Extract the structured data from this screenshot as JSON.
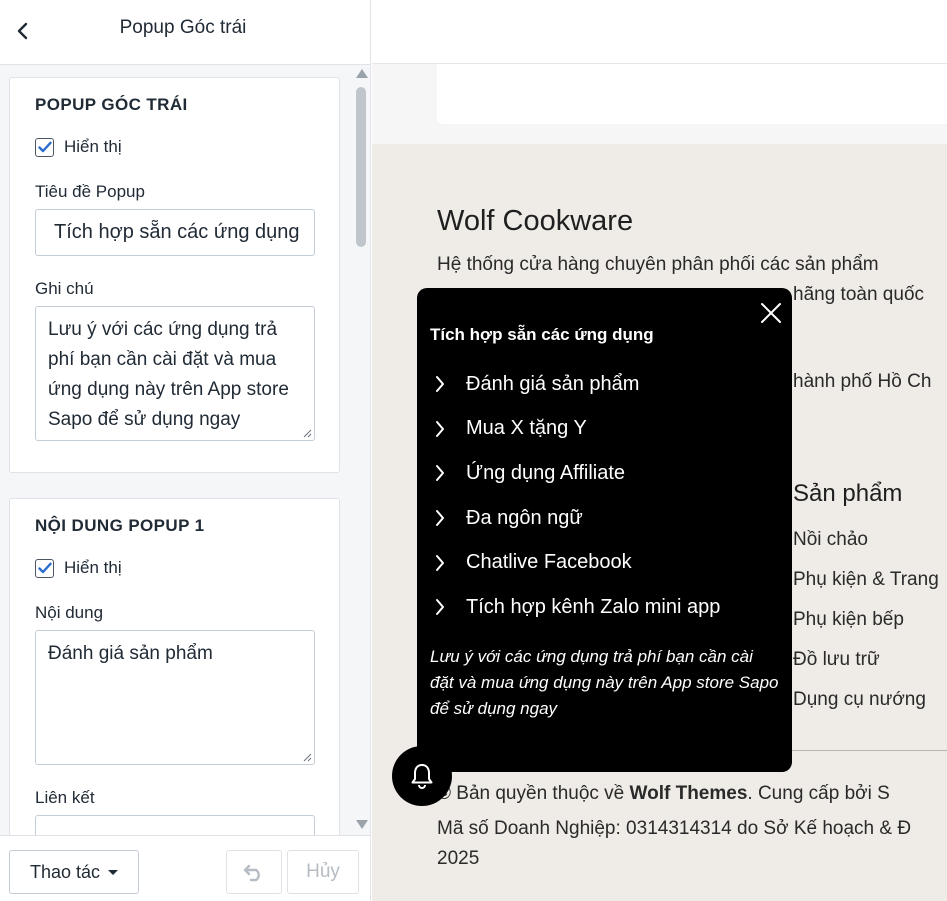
{
  "editor": {
    "title": "Popup Góc trái",
    "section1": {
      "heading": "POPUP GÓC TRÁI",
      "show_label": "Hiển thị",
      "popup_title_label": "Tiêu đề Popup",
      "popup_title_value": "Tích hợp sẵn các ứng dụng",
      "note_label": "Ghi chú",
      "note_value": "Lưu ý với các ứng dụng trả phí bạn cần cài đặt và mua ứng dụng này trên App store Sapo để sử dụng ngay"
    },
    "section2": {
      "heading": "NỘI DUNG POPUP 1",
      "show_label": "Hiển thị",
      "content_label": "Nội dung",
      "content_value": "Đánh giá sản phẩm",
      "link_label": "Liên kết"
    },
    "actions_label": "Thao tác",
    "cancel_label": "Hủy"
  },
  "preview": {
    "brand": "Wolf Cookware",
    "desc_line1": "Hệ thống cửa hàng chuyên phân phối các sản phẩm",
    "desc_line2": "hãng toàn quốc",
    "address": "hành phố Hồ Ch",
    "product_heading": "Sản phẩm",
    "product_links": [
      "Nồi chảo",
      "Phụ kiện & Trang",
      "Phụ kiện bếp",
      "Đồ lưu trữ",
      "Dụng cụ nướng"
    ],
    "copyright_prefix": "© Bản quyền thuộc về ",
    "copyright_brand": "Wolf Themes",
    "copyright_suffix": ". Cung cấp bởi S",
    "business_line": "Mã số Doanh Nghiệp: 0314314314 do Sở Kế hoạch & Đ",
    "year": "2025"
  },
  "popup": {
    "title": "Tích hợp sẵn các ứng dụng",
    "items": [
      "Đánh giá sản phẩm",
      "Mua X tặng Y",
      "Ứng dụng Affiliate",
      "Đa ngôn ngữ",
      "Chatlive Facebook",
      "Tích hợp kênh Zalo mini app"
    ],
    "note": "Lưu ý với các ứng dụng trả phí bạn cần cài đặt và mua ứng dụng này trên App store Sapo để sử dụng ngay"
  },
  "colors": {
    "accent": "#2c6ecb",
    "popup_bg": "#000000",
    "preview_bg": "#efebe6"
  },
  "icons": [
    "back-chevron-icon",
    "check-icon",
    "close-icon",
    "chevron-right-icon",
    "bell-icon",
    "undo-icon",
    "caret-down-icon"
  ]
}
